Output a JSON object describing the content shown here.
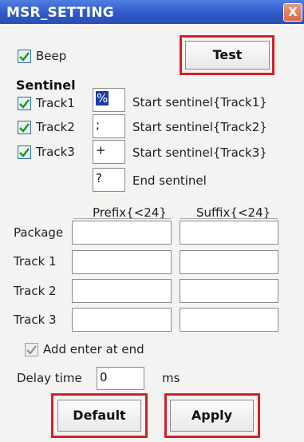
{
  "window": {
    "title": "MSR_SETTING",
    "close_glyph": "X"
  },
  "beep": {
    "label": "Beep",
    "checked": true
  },
  "test_button": {
    "label": "Test"
  },
  "sentinel": {
    "heading": "Sentinel",
    "tracks": [
      {
        "label": "Track1",
        "value": "%",
        "selected": true,
        "desc": "Start sentinel{Track1}",
        "checked": true
      },
      {
        "label": "Track2",
        "value": ";",
        "desc": "Start sentinel{Track2}",
        "checked": true
      },
      {
        "label": "Track3",
        "value": "+",
        "desc": "Start sentinel{Track3}",
        "checked": true
      }
    ],
    "end": {
      "value": "?",
      "desc": "End sentinel"
    }
  },
  "affix": {
    "prefix_header": "Prefix{<24}",
    "suffix_header": "Suffix{<24}",
    "rows": [
      {
        "label": "Package",
        "prefix": "",
        "suffix": ""
      },
      {
        "label": "Track 1",
        "prefix": "",
        "suffix": ""
      },
      {
        "label": "Track 2",
        "prefix": "",
        "suffix": ""
      },
      {
        "label": "Track 3",
        "prefix": "",
        "suffix": ""
      }
    ]
  },
  "add_enter": {
    "label": "Add enter at end",
    "checked": true,
    "disabled": true
  },
  "delay": {
    "label": "Delay time",
    "value": "0",
    "unit": "ms"
  },
  "buttons": {
    "default": "Default",
    "apply": "Apply"
  },
  "colors": {
    "titlebar": "#2f59c8",
    "highlight": "#d51f2b",
    "selection": "#1d3aa6"
  }
}
